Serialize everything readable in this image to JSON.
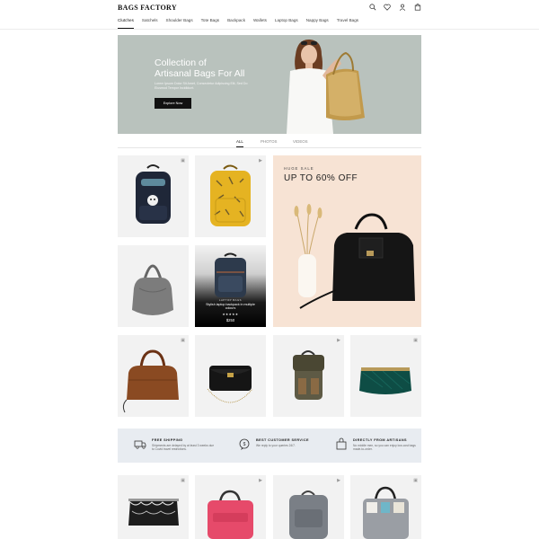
{
  "header": {
    "logo": "BAGS FACTORY",
    "icons": [
      "search-icon",
      "heart-icon",
      "user-icon",
      "cart-icon"
    ],
    "nav": [
      "Clutches",
      "Satchels",
      "Shoulder Bags",
      "Tote Bags",
      "Backpack",
      "Wallets",
      "Laptop Bags",
      "Nappy Bags",
      "Travel Bags"
    ],
    "active_nav": "Clutches"
  },
  "hero": {
    "title_line1": "Collection of",
    "title_line2": "Artisanal Bags For All",
    "subtitle": "Lorem Ipsum Dolor Sit Amet, Consectetur Adipiscing Elit, Sed Do Eiusmod Tempor Incididunt.",
    "button": "Explore Now"
  },
  "tabs": {
    "all": "ALL",
    "photos": "PHOTOS",
    "videos": "VIDEOS"
  },
  "promo": {
    "kicker": "HUGE SALE",
    "title": "UP TO 60% OFF"
  },
  "featured": {
    "category": "LAPTOP BAGS",
    "name": "Stylish laptop backpack in multiple colours",
    "stars": "★★★★★",
    "price": "$250"
  },
  "features": [
    {
      "title": "FREE SHIPPING",
      "text": "Shipments are delayed by at least 3 weeks due to Covid travel restrictions.",
      "icon": "shipping-icon"
    },
    {
      "title": "BEST CUSTOMER SERVICE",
      "text": "We reply to your queries 24/7.",
      "icon": "chat-icon"
    },
    {
      "title": "DIRECTLY FROM ARTISANS",
      "text": "No middle men, so you can enjoy low-cost bags made-to-order.",
      "icon": "bag-icon"
    }
  ],
  "colors": {
    "hero_bg": "#b9c2bd",
    "promo_bg": "#f7e3d4",
    "features_bg": "#e8ecf1",
    "tile_bg": "#f2f2f2"
  }
}
